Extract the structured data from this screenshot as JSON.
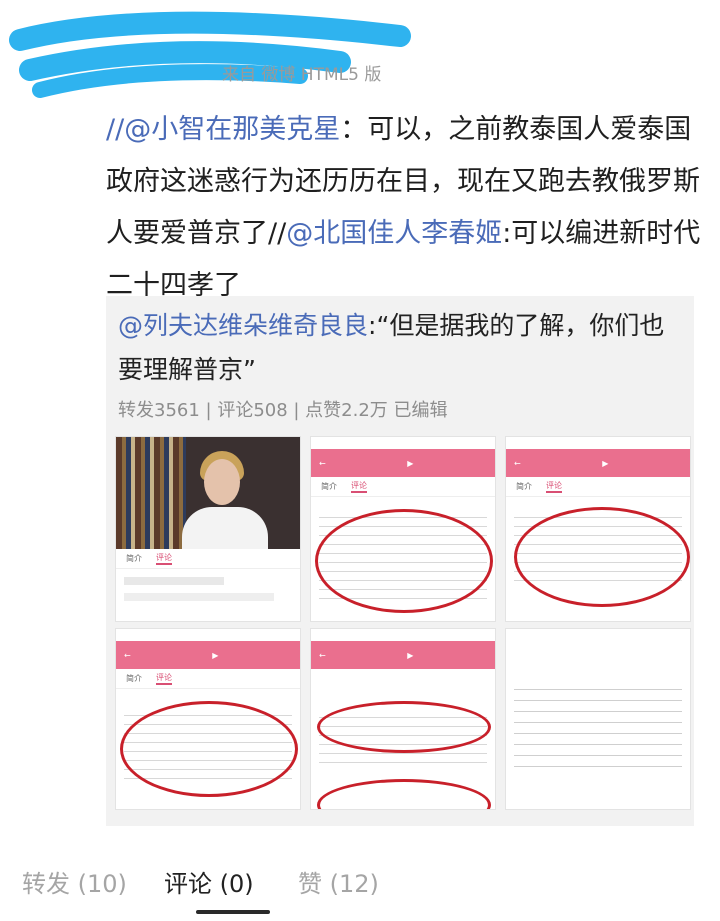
{
  "header": {
    "source_label": "来自 微博 HTML5 版"
  },
  "post": {
    "mention_1": "@小智在那美克星",
    "text_1": "：可以，之前教泰国人爱泰国政府这迷惑行为还历历在目，现在又跑去教俄罗斯人要爱普京了//",
    "prefix": "//",
    "mention_2": "@北国佳人李春姬",
    "text_2": ":可以编进新时代二十四孝了"
  },
  "quoted": {
    "mention": "@列夫达维朵维奇良良",
    "text": ":“但是据我的了解，你们也要理解普京”",
    "stats": "转发3561 | 评论508 | 点赞2.2万  已编辑"
  },
  "tabs": [
    {
      "label": "转发 (10)"
    },
    {
      "label": "评论 (0)"
    },
    {
      "label": "赞 (12)"
    }
  ],
  "colors": {
    "mention": "#4a6bb8",
    "app_pink": "#ea6f8e",
    "circle_red": "#c8202a"
  }
}
